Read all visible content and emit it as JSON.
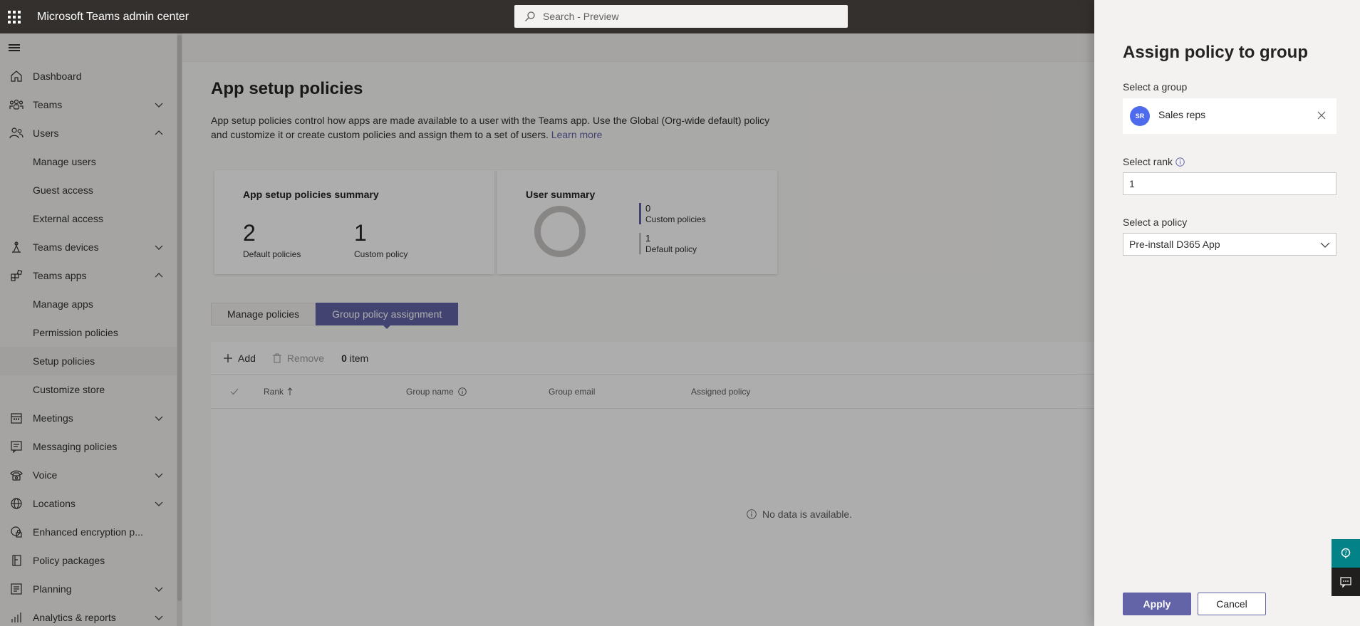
{
  "app": {
    "title": "Microsoft Teams admin center"
  },
  "search": {
    "placeholder": "Search - Preview"
  },
  "sidebar": {
    "items": [
      {
        "label": "Dashboard",
        "icon": "home-icon",
        "chevron": ""
      },
      {
        "label": "Teams",
        "icon": "teams-icon",
        "chevron": "down"
      },
      {
        "label": "Users",
        "icon": "users-icon",
        "chevron": "up"
      },
      {
        "label": "Manage users",
        "sub": true
      },
      {
        "label": "Guest access",
        "sub": true
      },
      {
        "label": "External access",
        "sub": true
      },
      {
        "label": "Teams devices",
        "icon": "devices-icon",
        "chevron": "down"
      },
      {
        "label": "Teams apps",
        "icon": "apps-icon",
        "chevron": "up"
      },
      {
        "label": "Manage apps",
        "sub": true
      },
      {
        "label": "Permission policies",
        "sub": true
      },
      {
        "label": "Setup policies",
        "sub": true,
        "active": true
      },
      {
        "label": "Customize store",
        "sub": true
      },
      {
        "label": "Meetings",
        "icon": "calendar-icon",
        "chevron": "down"
      },
      {
        "label": "Messaging policies",
        "icon": "message-icon",
        "chevron": ""
      },
      {
        "label": "Voice",
        "icon": "phone-icon",
        "chevron": "down"
      },
      {
        "label": "Locations",
        "icon": "globe-icon",
        "chevron": "down"
      },
      {
        "label": "Enhanced encryption p...",
        "icon": "lock-icon",
        "chevron": ""
      },
      {
        "label": "Policy packages",
        "icon": "package-icon",
        "chevron": ""
      },
      {
        "label": "Planning",
        "icon": "list-icon",
        "chevron": "down"
      },
      {
        "label": "Analytics & reports",
        "icon": "chart-icon",
        "chevron": "down"
      }
    ]
  },
  "main": {
    "title": "App setup policies",
    "description": "App setup policies control how apps are made available to a user with the Teams app. Use the Global (Org-wide default) policy and customize it or create custom policies and assign them to a set of users.",
    "learn_more": "Learn more",
    "summary_card": {
      "title": "App setup policies summary",
      "stat1_value": "2",
      "stat1_label": "Default policies",
      "stat2_value": "1",
      "stat2_label": "Custom policy"
    },
    "user_card": {
      "title": "User summary",
      "legend1_value": "0",
      "legend1_label": "Custom policies",
      "legend2_value": "1",
      "legend2_label": "Default policy",
      "legend1_color": "#6264a7",
      "legend2_color": "#c8c6c4"
    },
    "tabs": [
      "Manage policies",
      "Group policy assignment"
    ],
    "toolbar": {
      "add": "Add",
      "remove": "Remove",
      "count_value": "0",
      "count_label": "item"
    },
    "columns": [
      "Rank",
      "Group name",
      "Group email",
      "Assigned policy"
    ],
    "no_data": "No data is available."
  },
  "panel": {
    "title": "Assign policy to group",
    "group_label": "Select a group",
    "group_initials": "SR",
    "group_name": "Sales reps",
    "rank_label": "Select rank",
    "rank_value": "1",
    "policy_label": "Select a policy",
    "policy_value": "Pre-install D365 App",
    "apply": "Apply",
    "cancel": "Cancel"
  },
  "colors": {
    "accent": "#6264a7",
    "topbar": "#33302e",
    "help": "#038387"
  }
}
